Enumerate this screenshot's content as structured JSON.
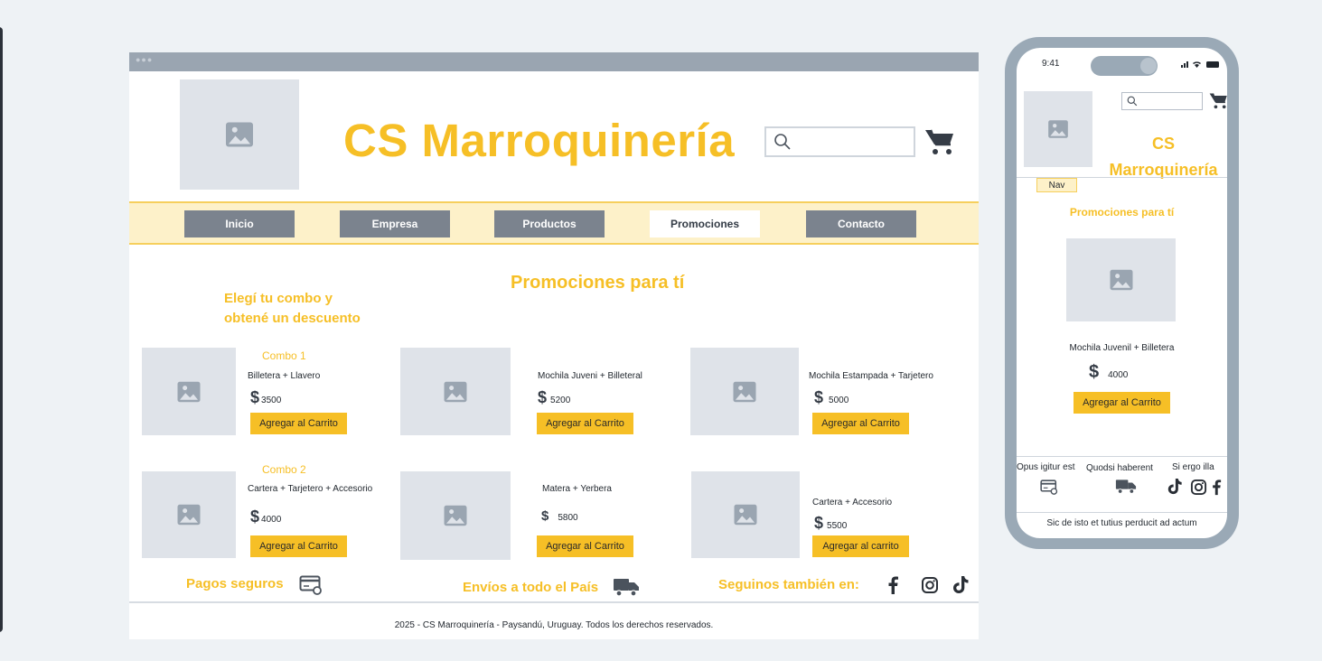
{
  "desktop": {
    "brand": "CS Marroquinería",
    "nav": [
      "Inicio",
      "Empresa",
      "Productos",
      "Promociones",
      "Contacto"
    ],
    "active_nav": "Promociones",
    "section_title": "Promociones para tí",
    "subtitle_line1": "Elegí tu combo y",
    "subtitle_line2": "obtené un descuento",
    "combo1_label": "Combo 1",
    "combo2_label": "Combo 2",
    "products": [
      {
        "name": "Billetera + Llavero",
        "currency": "$",
        "price": "3500",
        "button": "Agregar al Carrito"
      },
      {
        "name": "Mochila Juveni + Billeteral",
        "currency": "$",
        "price": "5200",
        "button": "Agregar al Carrito"
      },
      {
        "name": "Mochila Estampada + Tarjetero",
        "currency": "$",
        "price": "5000",
        "button": "Agregar al Carrito"
      },
      {
        "name": "Cartera + Tarjetero + Accesorio",
        "currency": "$",
        "price": "4000",
        "button": "Agregar al Carrito"
      },
      {
        "name": "Matera + Yerbera",
        "currency": "$",
        "price": "5800",
        "button": "Agregar al Carrito"
      },
      {
        "name": "Cartera + Accesorio",
        "currency": "$",
        "price": "5500",
        "button": "Agregar al carrito"
      }
    ],
    "features": {
      "payments": "Pagos seguros",
      "shipping": "Envíos a todo el País",
      "social": "Seguinos también en:"
    },
    "copyright": "2025 - CS Marroquinería - Paysandú, Uruguay. Todos los derechos reservados."
  },
  "mobile": {
    "time": "9:41",
    "brand_line1": "CS",
    "brand_line2": "Marroquinería",
    "nav_label": "Nav",
    "section_title": "Promociones para tí",
    "product_name": "Mochila Juvenil + Billetera",
    "currency": "$",
    "price": "4000",
    "button": "Agregar al Carrito",
    "footer_cols": [
      "Opus igitur est",
      "Quodsi haberent",
      "Si ergo illa"
    ],
    "footer_text": "Sic de isto et tutius perducit ad actum"
  },
  "colors": {
    "accent": "#f6bf26",
    "nav_bg": "#fdf1c9",
    "button_gray": "#7b838e",
    "placeholder": "#dfe3e9",
    "frame": "#9aa9b6"
  },
  "icons": [
    "image-icon",
    "search-icon",
    "cart-icon",
    "credit-card-icon",
    "truck-icon",
    "facebook-icon",
    "instagram-icon",
    "tiktok-icon",
    "signal-icon",
    "wifi-icon",
    "battery-icon"
  ]
}
